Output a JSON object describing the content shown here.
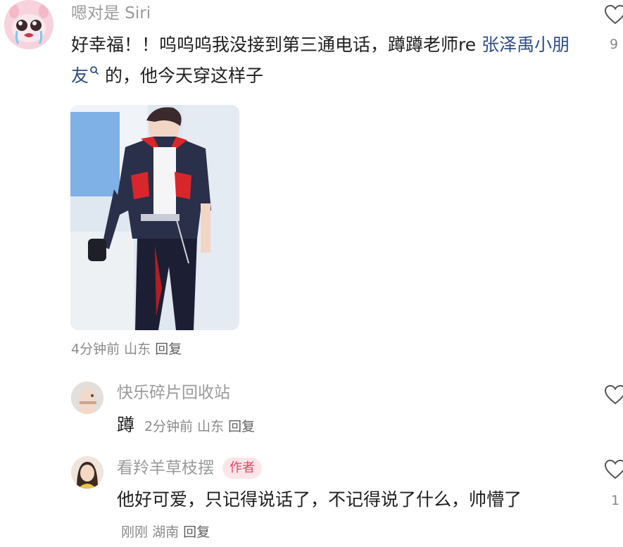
{
  "comments": [
    {
      "username": "嗯对是 Siri",
      "text_prefix": "好幸福！！呜呜呜我没接到第三通电话，蹲蹲老师re ",
      "mention": "张泽禹小朋友",
      "mention_icon": "search-icon",
      "text_suffix": " 的，他今天穿这样子",
      "time": "4分钟前",
      "location": "山东",
      "reply_label": "回复",
      "like_count": "9"
    }
  ],
  "replies": [
    {
      "username": "快乐碎片回收站",
      "text": "蹲",
      "time": "2分钟前",
      "location": "山东",
      "reply_label": "回复",
      "like_count": ""
    },
    {
      "username": "看羚羊草枝摆",
      "badge": "作者",
      "text": "他好可爱，只记得说话了，不记得说了什么，帅懵了",
      "time": "刚刚",
      "location": "湖南",
      "reply_label": "回复",
      "like_count": "1"
    }
  ],
  "colors": {
    "mention": "#2f4e86",
    "badge_bg": "#fde6e9",
    "badge_text": "#e24564",
    "meta": "#8a8a8a"
  }
}
